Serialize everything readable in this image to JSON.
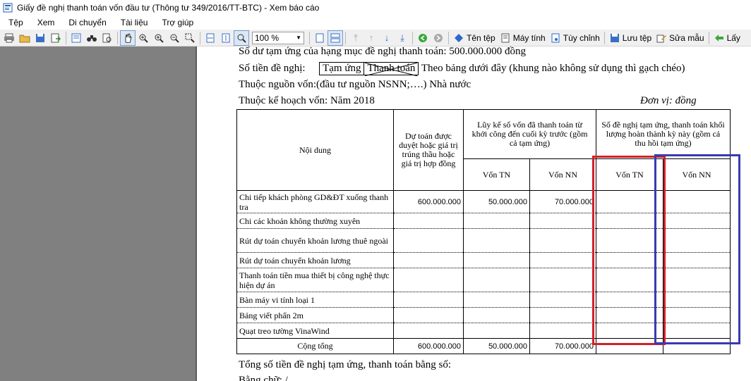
{
  "window": {
    "title": "Giấy đề nghị thanh toán vốn đầu tư (Thông tư 349/2016/TT-BTC) - Xem báo cáo"
  },
  "menu": [
    "Tệp",
    "Xem",
    "Di chuyển",
    "Tài liệu",
    "Trợ giúp"
  ],
  "toolbar": {
    "zoom": "100 %",
    "ten_tep": "Tên tệp",
    "may_tinh": "Máy tính",
    "tuy_chinh": "Tùy chỉnh",
    "luu_tep": "Lưu tệp",
    "sua_mau": "Sửa mẫu",
    "lay": "Lấy"
  },
  "doc": {
    "line1": "Số dư tạm ứng của hạng mục đề nghị thanh toán: 500.000.000 đồng",
    "so_tien_label": "Số tiền đề nghị:",
    "tam_ung": "Tạm ứng",
    "thanh_toan": "Thanh toán",
    "so_tien_suffix": "Theo bảng dưới đây (khung nào không sử dụng thì gạch chéo)",
    "nguon_von": "Thuộc nguồn vốn:(đầu tư nguồn NSNN;….) Nhà nước",
    "ke_hoach": "Thuộc kế hoạch vốn: Năm 2018",
    "don_vi": "Đơn vị: đồng",
    "footer": "Tổng số tiền đề nghị tạm ứng, thanh toán bằng số:",
    "footer2": "Bằng chữ: /"
  },
  "table": {
    "h_noidung": "Nội dung",
    "h_dutoan": "Dự toán được duyệt hoặc giá trị trúng thầu hoặc giá trị hợp đồng",
    "h_luyke": "Lũy kế số vốn đã thanh toán từ khởi công đến cuối kỳ trước (gồm cả tạm ứng)",
    "h_denghi": "Số đề nghị tạm ứng, thanh toán khối lượng hoàn thành kỳ này (gồm cả thu hồi tạm ứng)",
    "h_von_tn": "Vốn TN",
    "h_von_nn": "Vốn NN",
    "rows": [
      {
        "noidung": "Chi tiếp khách phòng GD&ĐT xuống thanh tra",
        "dutoan": "600.000.000",
        "lk_tn": "50.000.000",
        "lk_nn": "70.000.000"
      },
      {
        "noidung": "Chi các khoản không thường xuyên",
        "dutoan": "",
        "lk_tn": "",
        "lk_nn": ""
      },
      {
        "noidung": "Rút dự toán chuyển khoản lương thuê ngoài",
        "dutoan": "",
        "lk_tn": "",
        "lk_nn": ""
      },
      {
        "noidung": "Rút dự toán chuyển khoản lương",
        "dutoan": "",
        "lk_tn": "",
        "lk_nn": ""
      },
      {
        "noidung": "Thanh toán tiền mua thiết bị công nghệ thực hiện dự án",
        "dutoan": "",
        "lk_tn": "",
        "lk_nn": ""
      },
      {
        "noidung": "Bàn máy vi tính loại 1",
        "dutoan": "",
        "lk_tn": "",
        "lk_nn": ""
      },
      {
        "noidung": "Bảng viết phấn 2m",
        "dutoan": "",
        "lk_tn": "",
        "lk_nn": ""
      },
      {
        "noidung": "Quạt treo tường VinaWind",
        "dutoan": "",
        "lk_tn": "",
        "lk_nn": ""
      }
    ],
    "total": {
      "label": "Cộng tổng",
      "dutoan": "600.000.000",
      "lk_tn": "50.000.000",
      "lk_nn": "70.000.000"
    }
  },
  "colors": {
    "highlight_red": "#d0202a",
    "highlight_blue": "#3a3ab0"
  }
}
